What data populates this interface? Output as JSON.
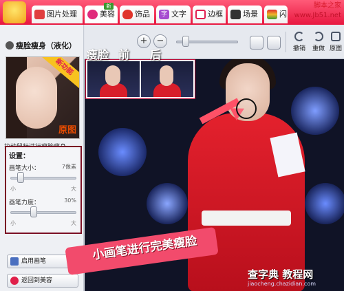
{
  "app": {
    "logo_icon": "meitu-logo-icon"
  },
  "tabs": [
    {
      "label": "图片处理",
      "icon": "image-process-icon",
      "color": "#e03e3e"
    },
    {
      "label": "美容",
      "icon": "beauty-icon",
      "color": "#e02b7b",
      "active": true,
      "badge": "新"
    },
    {
      "label": "饰品",
      "icon": "accessory-icon",
      "color": "#e0352b"
    },
    {
      "label": "文字",
      "icon": "text-icon",
      "color": "#a64bd0",
      "glyph": "字"
    },
    {
      "label": "边框",
      "icon": "frame-icon",
      "color": "#e02050"
    },
    {
      "label": "场景",
      "icon": "scene-icon",
      "color": "#333333"
    },
    {
      "label": "闪",
      "icon": "flash-icon",
      "color": "#f0b52a"
    }
  ],
  "site": {
    "name": "脚本之家",
    "url": "www.Jb51.net"
  },
  "panel": {
    "title": "瘦脸瘦身（液化）",
    "preview": {
      "ribbon": "新功能",
      "original_label": "原图"
    },
    "hint": "拉动鼠标进行瘦脸瘦身。",
    "settings": {
      "title": "设置：",
      "brush_size": {
        "label": "画笔大小：",
        "value": "7像素",
        "min": "小",
        "max": "大",
        "level": 0.1
      },
      "brush_force": {
        "label": "画笔力度：",
        "value": "30%",
        "min": "小",
        "max": "大",
        "level": 0.3
      }
    },
    "enable_brush": "启用画笔",
    "back_beauty": "返回到美容"
  },
  "toolbar": {
    "zoom_in": "+",
    "zoom_out": "−",
    "undo": "撤销",
    "redo": "重做",
    "original": "原图"
  },
  "annotations": {
    "compare_labels": [
      "瘦脸",
      "前",
      "后"
    ],
    "banner": "小画笔进行完美瘦脸",
    "watermark_title": "查字典 教程网",
    "watermark_url": "jiaocheng.chazidian.com"
  },
  "colors": {
    "tab_bar": "#e8173f",
    "settings_border": "#7a0f24",
    "accent_pink": "#ff5167"
  }
}
